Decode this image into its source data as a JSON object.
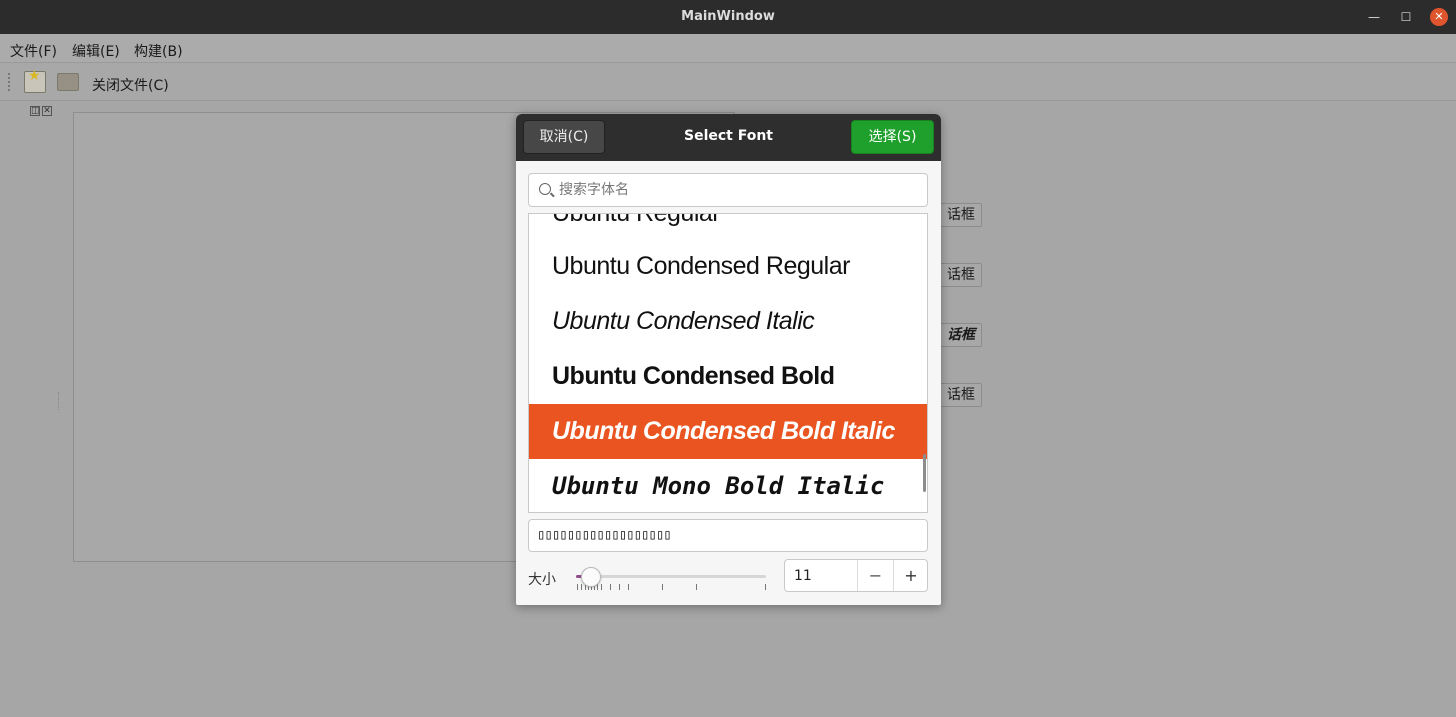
{
  "window": {
    "title": "MainWindow",
    "minimize_glyph": "—",
    "maximize_glyph": "☐",
    "close_glyph": "✕"
  },
  "menubar": {
    "items": [
      "文件(F)",
      "编辑(E)",
      "构建(B)"
    ]
  },
  "toolbar": {
    "new_icon": "new-file-icon",
    "open_icon": "open-folder-icon",
    "close_file_label": "关闭文件(C)"
  },
  "background_buttons": [
    "话框",
    "话框",
    "话框",
    "话框"
  ],
  "dialog": {
    "title": "Select Font",
    "cancel_label": "取消(C)",
    "select_label": "选择(S)",
    "accent_color": "#e95420",
    "select_color": "#1fa02c",
    "search": {
      "placeholder": "搜索字体名",
      "value": ""
    },
    "fonts": [
      "Ubuntu Regular",
      "Ubuntu Condensed Regular",
      "Ubuntu Condensed Italic",
      "Ubuntu Condensed Bold",
      "Ubuntu Condensed Bold Italic",
      "Ubuntu Mono Bold Italic"
    ],
    "selected_font": "Ubuntu Condensed Bold Italic",
    "preview_text": "▯▯▯▯▯▯▯▯▯▯▯▯▯▯▯▯▯▯",
    "size": {
      "label": "大小",
      "value": "11",
      "minus": "−",
      "plus": "+"
    }
  }
}
